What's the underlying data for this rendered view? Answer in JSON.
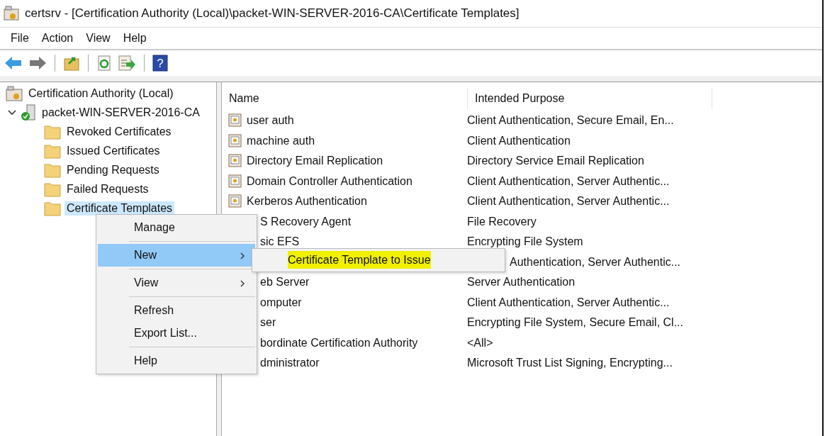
{
  "window": {
    "title": "certsrv - [Certification Authority (Local)\\packet-WIN-SERVER-2016-CA\\Certificate Templates]"
  },
  "menu_bar": [
    "File",
    "Action",
    "View",
    "Help"
  ],
  "toolbar": [
    {
      "kind": "back"
    },
    {
      "kind": "forward"
    },
    {
      "kind": "up"
    },
    {
      "kind": "refresh"
    },
    {
      "kind": "export"
    },
    {
      "kind": "help",
      "label": "?"
    }
  ],
  "tree": {
    "label": "Certification Authority (Local)",
    "children": [
      {
        "label": "packet-WIN-SERVER-2016-CA",
        "expanded": true,
        "children": [
          {
            "label": "Revoked Certificates",
            "selected": false
          },
          {
            "label": "Issued Certificates",
            "selected": false
          },
          {
            "label": "Pending Requests",
            "selected": false
          },
          {
            "label": "Failed Requests",
            "selected": false
          },
          {
            "label": "Certificate Templates",
            "selected": true
          }
        ]
      }
    ]
  },
  "table": {
    "columns": [
      "Name",
      "Intended Purpose"
    ],
    "rows": [
      {
        "kind": "full",
        "name": "user auth",
        "purpose": "Client Authentication, Secure Email, En..."
      },
      {
        "kind": "full",
        "name": "machine auth",
        "purpose": "Client Authentication"
      },
      {
        "kind": "full",
        "name": "Directory Email Replication",
        "purpose": "Directory Service Email Replication"
      },
      {
        "kind": "full",
        "name": "Domain Controller Authentication",
        "purpose": "Client Authentication, Server Authentic..."
      },
      {
        "kind": "full",
        "name": "Kerberos Authentication",
        "purpose": "Client Authentication, Server Authentic..."
      },
      {
        "kind": "covered",
        "name": "S Recovery Agent",
        "purpose": "File Recovery"
      },
      {
        "kind": "covered",
        "name": "sic EFS",
        "purpose": "Encrypting File System"
      },
      {
        "kind": "hidden",
        "purpose": "Authentication, Server Authentic..."
      },
      {
        "kind": "covered",
        "name": "eb Server",
        "purpose": "Server Authentication"
      },
      {
        "kind": "covered",
        "name": "omputer",
        "purpose": "Client Authentication, Server Authentic..."
      },
      {
        "kind": "covered",
        "name": "ser",
        "purpose": "Encrypting File System, Secure Email, Cl..."
      },
      {
        "kind": "covered",
        "name": "bordinate Certification Authority",
        "purpose": "<All>"
      },
      {
        "kind": "covered",
        "name": "dministrator",
        "purpose": "Microsoft Trust List Signing, Encrypting..."
      }
    ]
  },
  "context_menu": {
    "items": [
      {
        "kind": "item",
        "label": "Manage",
        "selected": false,
        "submenu": false
      },
      {
        "kind": "separator"
      },
      {
        "kind": "item",
        "label": "New",
        "selected": true,
        "submenu": true
      },
      {
        "kind": "separator"
      },
      {
        "kind": "item",
        "label": "View",
        "selected": false,
        "submenu": true
      },
      {
        "kind": "separator"
      },
      {
        "kind": "item",
        "label": "Refresh",
        "selected": false,
        "submenu": false
      },
      {
        "kind": "item",
        "label": "Export List...",
        "selected": false,
        "submenu": false
      },
      {
        "kind": "separator"
      },
      {
        "kind": "item",
        "label": "Help",
        "selected": false,
        "submenu": false
      }
    ]
  },
  "submenu": {
    "items": [
      {
        "label": "Certificate Template to Issue",
        "highlighted": true
      }
    ]
  }
}
